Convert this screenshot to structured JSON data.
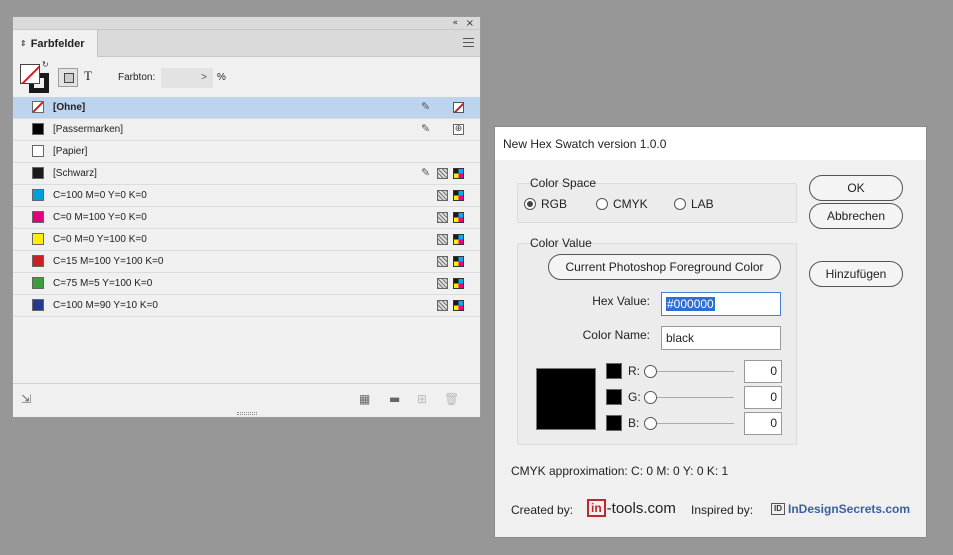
{
  "panel": {
    "collapse_icon": "«",
    "close_icon": "×",
    "tab_label": "Farbfelder",
    "tint_label": "Farbton:",
    "tint_value": "",
    "tint_unit": "%",
    "text_button": "T",
    "swatches": [
      {
        "name": "[Ohne]",
        "color": "none",
        "selected": true,
        "pencil": true,
        "proc": false,
        "type": "none"
      },
      {
        "name": "[Passermarken]",
        "color": "#000000",
        "selected": false,
        "pencil": true,
        "proc": false,
        "type": "registration"
      },
      {
        "name": "[Papier]",
        "color": "#ffffff",
        "selected": false,
        "pencil": false,
        "proc": false,
        "type": ""
      },
      {
        "name": "[Schwarz]",
        "color": "#1a1a1a",
        "selected": false,
        "pencil": true,
        "proc": true,
        "type": "cmyk"
      },
      {
        "name": "C=100 M=0 Y=0 K=0",
        "color": "#00a0dc",
        "selected": false,
        "pencil": false,
        "proc": true,
        "type": "cmyk"
      },
      {
        "name": "C=0 M=100 Y=0 K=0",
        "color": "#e0007a",
        "selected": false,
        "pencil": false,
        "proc": true,
        "type": "cmyk"
      },
      {
        "name": "C=0 M=0 Y=100 K=0",
        "color": "#ffee00",
        "selected": false,
        "pencil": false,
        "proc": true,
        "type": "cmyk"
      },
      {
        "name": "C=15 M=100 Y=100 K=0",
        "color": "#cc1f24",
        "selected": false,
        "pencil": false,
        "proc": true,
        "type": "cmyk"
      },
      {
        "name": "C=75 M=5 Y=100 K=0",
        "color": "#3a9e3c",
        "selected": false,
        "pencil": false,
        "proc": true,
        "type": "cmyk"
      },
      {
        "name": "C=100 M=90 Y=10 K=0",
        "color": "#253a8c",
        "selected": false,
        "pencil": false,
        "proc": true,
        "type": "cmyk"
      }
    ]
  },
  "dialog": {
    "title": "New Hex Swatch version 1.0.0",
    "color_space": {
      "legend": "Color Space",
      "options": [
        "RGB",
        "CMYK",
        "LAB"
      ],
      "selected": "RGB"
    },
    "color_value": {
      "legend": "Color Value",
      "foreground_button": "Current Photoshop Foreground Color",
      "hex_label": "Hex Value:",
      "hex_value": "#000000",
      "name_label": "Color Name:",
      "name_value": "black",
      "preview_color": "#000000",
      "channels": [
        {
          "label": "R:",
          "value": "0"
        },
        {
          "label": "G:",
          "value": "0"
        },
        {
          "label": "B:",
          "value": "0"
        }
      ]
    },
    "buttons": {
      "ok": "OK",
      "cancel": "Abbrechen",
      "add": "Hinzufügen"
    },
    "cmyk_approx": "CMYK approximation: C: 0 M: 0 Y: 0 K: 1",
    "created_label": "Created by:",
    "intools_logo": {
      "prefix": "in",
      "suffix": "-tools.com"
    },
    "inspired_label": "Inspired by:",
    "ids_logo": {
      "mark": "ID",
      "text": "InDesignSecrets.com"
    }
  }
}
